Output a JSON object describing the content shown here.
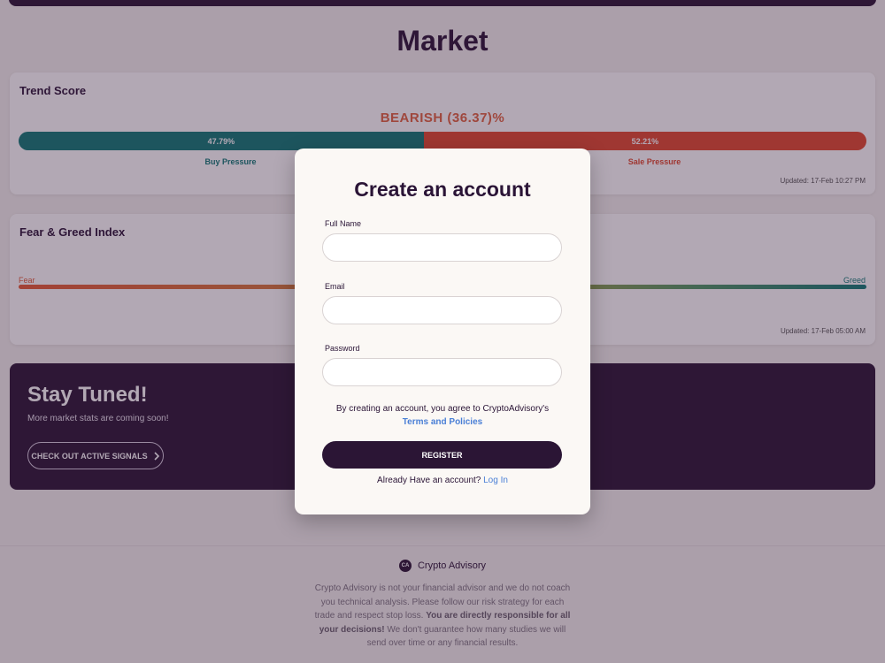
{
  "page": {
    "title": "Market"
  },
  "trend": {
    "title": "Trend Score",
    "label": "BEARISH (36.37)%",
    "buy_pct": 47.79,
    "sale_pct": 52.21,
    "buy_text": "47.79%",
    "sale_text": "52.21%",
    "buy_label": "Buy Pressure",
    "sale_label": "Sale Pressure",
    "updated": "Updated: 17-Feb 10:27 PM"
  },
  "fear_greed": {
    "title": "Fear & Greed Index",
    "fear_label": "Fear",
    "greed_label": "Greed",
    "updated": "Updated: 17-Feb 05:00 AM"
  },
  "tuned": {
    "title": "Stay Tuned!",
    "text": "More market stats are coming soon!",
    "button_label": "CHECK OUT ACTIVE SIGNALS"
  },
  "footer": {
    "brand": "Crypto Advisory",
    "logo_text": "CA",
    "disclaimer_1": "Crypto Advisory is not your financial advisor and we do not coach you technical analysis. Please follow our risk strategy for each trade and respect stop loss. ",
    "disclaimer_bold": "You are directly responsible for all your decisions!",
    "disclaimer_2": " We don't guarantee how many studies we will send over time or any financial results."
  },
  "modal": {
    "title": "Create an account",
    "full_name_label": "Full Name",
    "full_name_value": "",
    "email_label": "Email",
    "email_value": "",
    "password_label": "Password",
    "password_value": "",
    "agree_text": "By creating an account, you agree to CryptoAdvisory's",
    "terms_link": "Terms and Policies",
    "register_label": "REGISTER",
    "have_account": "Already Have an account?",
    "login_link": "Log In"
  },
  "colors": {
    "brand": "#2b1535",
    "buy": "#0f7a75",
    "sale": "#e14a2e",
    "link": "#4a7fd6"
  }
}
